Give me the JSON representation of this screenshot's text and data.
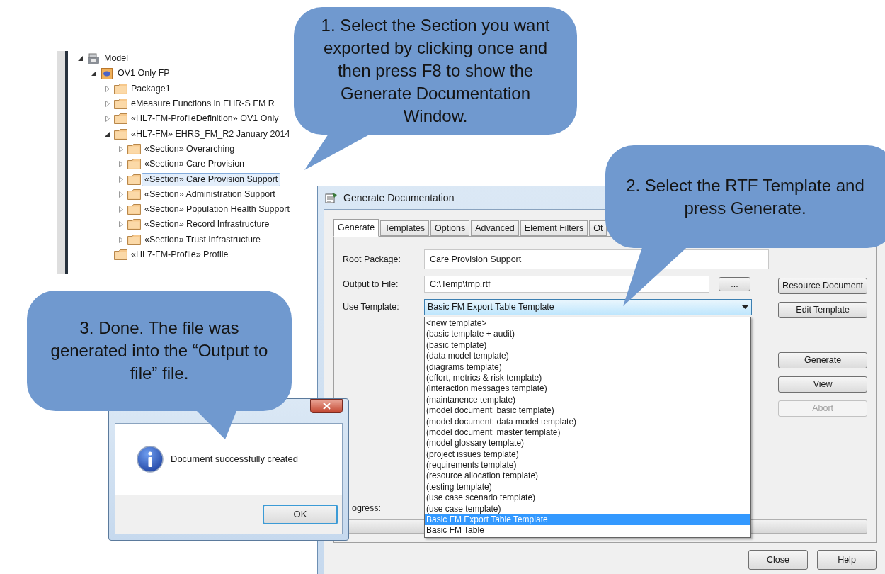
{
  "callouts": [
    {
      "text": "1. Select the Section you want exported by clicking once and then press F8 to show the Generate Documentation Window."
    },
    {
      "text": "2. Select the RTF Template and press Generate."
    },
    {
      "text": "3. Done. The file was generated into the “Output to file” file."
    }
  ],
  "tree": [
    {
      "label": "Model",
      "kind": "model",
      "expanded": true,
      "selected": false,
      "children": [
        {
          "label": "OV1 Only FP",
          "kind": "package",
          "expanded": true,
          "selected": false,
          "children": [
            {
              "label": "Package1",
              "kind": "folder",
              "expanded": false,
              "selected": false
            },
            {
              "label": "eMeasure Functions in EHR-S FM R",
              "kind": "folder",
              "expanded": false,
              "selected": false
            },
            {
              "label": "«HL7-FM-ProfileDefinition» OV1 Only",
              "kind": "folder",
              "expanded": false,
              "selected": false
            },
            {
              "label": "«HL7-FM» EHRS_FM_R2 January 2014",
              "kind": "folder",
              "expanded": true,
              "selected": false,
              "children": [
                {
                  "label": "«Section» Overarching",
                  "kind": "folder",
                  "expanded": false,
                  "selected": false
                },
                {
                  "label": "«Section» Care Provision",
                  "kind": "folder",
                  "expanded": false,
                  "selected": false
                },
                {
                  "label": "«Section» Care Provision Support",
                  "kind": "folder",
                  "expanded": false,
                  "selected": true
                },
                {
                  "label": "«Section» Administration Support",
                  "kind": "folder",
                  "expanded": false,
                  "selected": false
                },
                {
                  "label": "«Section» Population Health Support",
                  "kind": "folder",
                  "expanded": false,
                  "selected": false
                },
                {
                  "label": "«Section» Record Infrastructure",
                  "kind": "folder",
                  "expanded": false,
                  "selected": false
                },
                {
                  "label": "«Section» Trust Infrastructure",
                  "kind": "folder",
                  "expanded": false,
                  "selected": false
                }
              ]
            },
            {
              "label": "«HL7-FM-Profile» Profile",
              "kind": "leaf",
              "selected": false
            }
          ]
        }
      ]
    }
  ],
  "dialog": {
    "title": "Generate Documentation",
    "tabs": [
      {
        "label": "Generate",
        "selected": true
      },
      {
        "label": "Templates",
        "selected": false
      },
      {
        "label": "Options",
        "selected": false
      },
      {
        "label": "Advanced",
        "selected": false
      },
      {
        "label": "Element Filters",
        "selected": false
      },
      {
        "label": "Ot",
        "selected": false
      }
    ],
    "root_package": {
      "label": "Root Package:",
      "value": "Care Provision Support"
    },
    "output_file": {
      "label": "Output to File:",
      "value": "C:\\Temp\\tmp.rtf",
      "browse": "..."
    },
    "template": {
      "label": "Use Template:",
      "value": "Basic FM Export Table Template",
      "expanded": true
    },
    "template_options": [
      {
        "label": "<new template>",
        "selected": false
      },
      {
        "label": "(basic template + audit)",
        "selected": false
      },
      {
        "label": "(basic template)",
        "selected": false
      },
      {
        "label": "(data model template)",
        "selected": false
      },
      {
        "label": "(diagrams template)",
        "selected": false
      },
      {
        "label": "(effort, metrics & risk template)",
        "selected": false
      },
      {
        "label": "(interaction messages template)",
        "selected": false
      },
      {
        "label": "(maintanence template)",
        "selected": false
      },
      {
        "label": "(model document: basic template)",
        "selected": false
      },
      {
        "label": "(model document: data model template)",
        "selected": false
      },
      {
        "label": "(model document: master template)",
        "selected": false
      },
      {
        "label": "(model glossary template)",
        "selected": false
      },
      {
        "label": "(project issues template)",
        "selected": false
      },
      {
        "label": "(requirements template)",
        "selected": false
      },
      {
        "label": "(resource allocation template)",
        "selected": false
      },
      {
        "label": "(testing template)",
        "selected": false
      },
      {
        "label": "(use case scenario template)",
        "selected": false
      },
      {
        "label": "(use case template)",
        "selected": false
      },
      {
        "label": "Basic FM Export Table Template",
        "selected": true
      },
      {
        "label": "Basic FM Table",
        "selected": false
      }
    ],
    "side_buttons": [
      {
        "label": "Resource Document",
        "disabled": false
      },
      {
        "label": "Edit Template",
        "disabled": false
      },
      {
        "label": "Generate",
        "disabled": false
      },
      {
        "label": "View",
        "disabled": false
      },
      {
        "label": "Abort",
        "disabled": true
      }
    ],
    "progress": {
      "label": "ogress:",
      "level": 0
    },
    "footer_buttons": [
      "Close",
      "Help"
    ]
  },
  "message_box": {
    "message": "Document successfully created",
    "ok": "OK"
  }
}
